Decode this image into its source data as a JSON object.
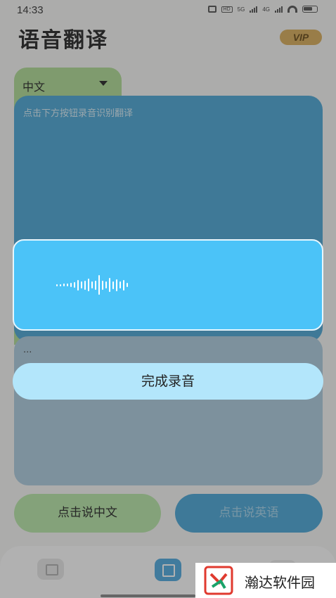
{
  "status_bar": {
    "time": "14:33",
    "hd": "HD",
    "net1": "5G",
    "net2": "4G"
  },
  "header": {
    "title": "语音翻译",
    "vip": "VIP"
  },
  "source_lang": {
    "label": "中文"
  },
  "source_panel": {
    "hint": "点击下方按钮录音识别翻译"
  },
  "target_panel": {
    "placeholder": "..."
  },
  "buttons": {
    "speak_zh": "点击说中文",
    "speak_en": "点击说英语"
  },
  "recording": {
    "finish_label": "完成录音",
    "waveform_levels": [
      0.1,
      0.1,
      0.15,
      0.15,
      0.2,
      0.3,
      0.55,
      0.35,
      0.45,
      0.65,
      0.35,
      0.45,
      1.0,
      0.45,
      0.35,
      0.7,
      0.4,
      0.6,
      0.35,
      0.55,
      0.2
    ]
  },
  "tab_bar": {
    "tabs": [
      {
        "icon": "image-edit-icon"
      },
      {
        "icon": "translate-icon"
      },
      {
        "icon": "profile-icon"
      }
    ]
  },
  "watermark": {
    "text": "瀚达软件园"
  },
  "colors": {
    "accent_blue": "#3c9fd3",
    "record_blue": "#4bc3f8",
    "green": "#a9d98c",
    "vip_gold": "#d6a64a"
  }
}
